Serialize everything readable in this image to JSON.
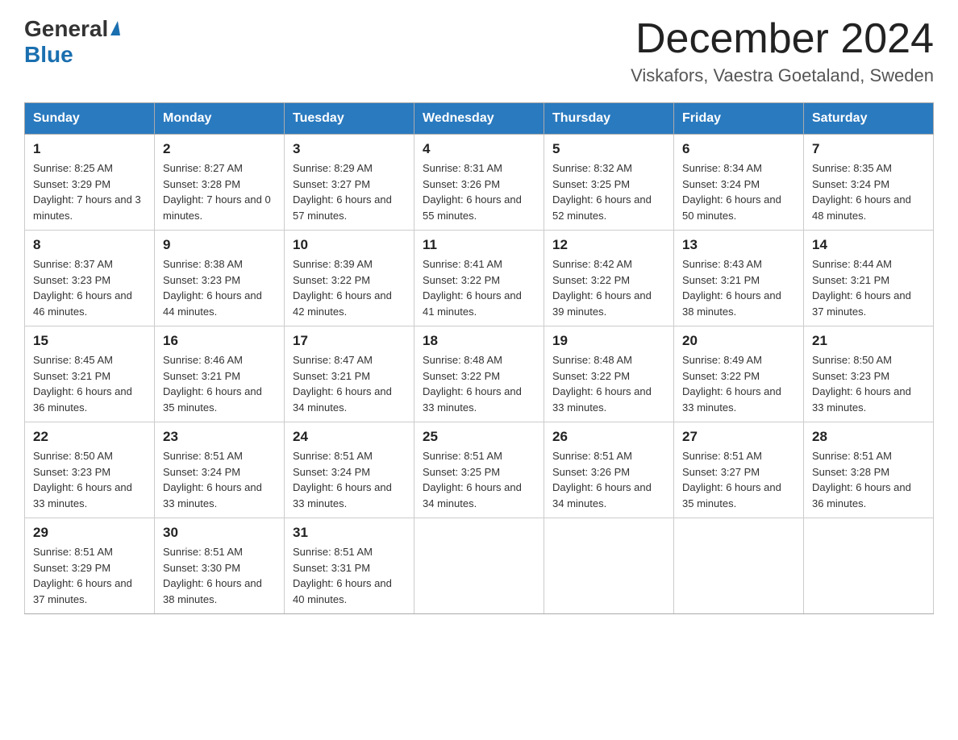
{
  "header": {
    "logo_general": "General",
    "logo_blue": "Blue",
    "month_title": "December 2024",
    "location": "Viskafors, Vaestra Goetaland, Sweden"
  },
  "calendar": {
    "days_of_week": [
      "Sunday",
      "Monday",
      "Tuesday",
      "Wednesday",
      "Thursday",
      "Friday",
      "Saturday"
    ],
    "weeks": [
      [
        {
          "day": "1",
          "sunrise": "8:25 AM",
          "sunset": "3:29 PM",
          "daylight": "7 hours and 3 minutes."
        },
        {
          "day": "2",
          "sunrise": "8:27 AM",
          "sunset": "3:28 PM",
          "daylight": "7 hours and 0 minutes."
        },
        {
          "day": "3",
          "sunrise": "8:29 AM",
          "sunset": "3:27 PM",
          "daylight": "6 hours and 57 minutes."
        },
        {
          "day": "4",
          "sunrise": "8:31 AM",
          "sunset": "3:26 PM",
          "daylight": "6 hours and 55 minutes."
        },
        {
          "day": "5",
          "sunrise": "8:32 AM",
          "sunset": "3:25 PM",
          "daylight": "6 hours and 52 minutes."
        },
        {
          "day": "6",
          "sunrise": "8:34 AM",
          "sunset": "3:24 PM",
          "daylight": "6 hours and 50 minutes."
        },
        {
          "day": "7",
          "sunrise": "8:35 AM",
          "sunset": "3:24 PM",
          "daylight": "6 hours and 48 minutes."
        }
      ],
      [
        {
          "day": "8",
          "sunrise": "8:37 AM",
          "sunset": "3:23 PM",
          "daylight": "6 hours and 46 minutes."
        },
        {
          "day": "9",
          "sunrise": "8:38 AM",
          "sunset": "3:23 PM",
          "daylight": "6 hours and 44 minutes."
        },
        {
          "day": "10",
          "sunrise": "8:39 AM",
          "sunset": "3:22 PM",
          "daylight": "6 hours and 42 minutes."
        },
        {
          "day": "11",
          "sunrise": "8:41 AM",
          "sunset": "3:22 PM",
          "daylight": "6 hours and 41 minutes."
        },
        {
          "day": "12",
          "sunrise": "8:42 AM",
          "sunset": "3:22 PM",
          "daylight": "6 hours and 39 minutes."
        },
        {
          "day": "13",
          "sunrise": "8:43 AM",
          "sunset": "3:21 PM",
          "daylight": "6 hours and 38 minutes."
        },
        {
          "day": "14",
          "sunrise": "8:44 AM",
          "sunset": "3:21 PM",
          "daylight": "6 hours and 37 minutes."
        }
      ],
      [
        {
          "day": "15",
          "sunrise": "8:45 AM",
          "sunset": "3:21 PM",
          "daylight": "6 hours and 36 minutes."
        },
        {
          "day": "16",
          "sunrise": "8:46 AM",
          "sunset": "3:21 PM",
          "daylight": "6 hours and 35 minutes."
        },
        {
          "day": "17",
          "sunrise": "8:47 AM",
          "sunset": "3:21 PM",
          "daylight": "6 hours and 34 minutes."
        },
        {
          "day": "18",
          "sunrise": "8:48 AM",
          "sunset": "3:22 PM",
          "daylight": "6 hours and 33 minutes."
        },
        {
          "day": "19",
          "sunrise": "8:48 AM",
          "sunset": "3:22 PM",
          "daylight": "6 hours and 33 minutes."
        },
        {
          "day": "20",
          "sunrise": "8:49 AM",
          "sunset": "3:22 PM",
          "daylight": "6 hours and 33 minutes."
        },
        {
          "day": "21",
          "sunrise": "8:50 AM",
          "sunset": "3:23 PM",
          "daylight": "6 hours and 33 minutes."
        }
      ],
      [
        {
          "day": "22",
          "sunrise": "8:50 AM",
          "sunset": "3:23 PM",
          "daylight": "6 hours and 33 minutes."
        },
        {
          "day": "23",
          "sunrise": "8:51 AM",
          "sunset": "3:24 PM",
          "daylight": "6 hours and 33 minutes."
        },
        {
          "day": "24",
          "sunrise": "8:51 AM",
          "sunset": "3:24 PM",
          "daylight": "6 hours and 33 minutes."
        },
        {
          "day": "25",
          "sunrise": "8:51 AM",
          "sunset": "3:25 PM",
          "daylight": "6 hours and 34 minutes."
        },
        {
          "day": "26",
          "sunrise": "8:51 AM",
          "sunset": "3:26 PM",
          "daylight": "6 hours and 34 minutes."
        },
        {
          "day": "27",
          "sunrise": "8:51 AM",
          "sunset": "3:27 PM",
          "daylight": "6 hours and 35 minutes."
        },
        {
          "day": "28",
          "sunrise": "8:51 AM",
          "sunset": "3:28 PM",
          "daylight": "6 hours and 36 minutes."
        }
      ],
      [
        {
          "day": "29",
          "sunrise": "8:51 AM",
          "sunset": "3:29 PM",
          "daylight": "6 hours and 37 minutes."
        },
        {
          "day": "30",
          "sunrise": "8:51 AM",
          "sunset": "3:30 PM",
          "daylight": "6 hours and 38 minutes."
        },
        {
          "day": "31",
          "sunrise": "8:51 AM",
          "sunset": "3:31 PM",
          "daylight": "6 hours and 40 minutes."
        },
        null,
        null,
        null,
        null
      ]
    ]
  }
}
